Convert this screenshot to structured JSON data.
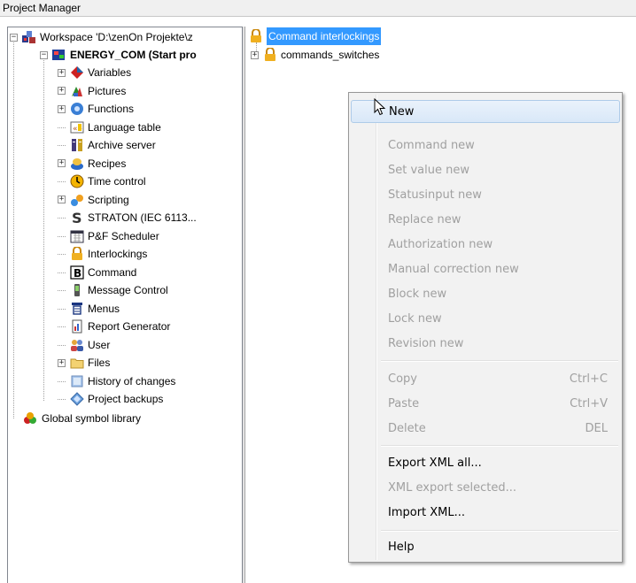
{
  "window": {
    "title": "Project Manager"
  },
  "tree": {
    "workspace_label": "Workspace 'D:\\zenOn Projekte\\z",
    "project_label": "ENERGY_COM (Start pro",
    "items": [
      {
        "label": "Variables",
        "icon": "variables-icon",
        "expandable": true
      },
      {
        "label": "Pictures",
        "icon": "pictures-icon",
        "expandable": true
      },
      {
        "label": "Functions",
        "icon": "functions-icon",
        "expandable": true
      },
      {
        "label": "Language table",
        "icon": "language-table-icon",
        "expandable": false
      },
      {
        "label": "Archive server",
        "icon": "archive-server-icon",
        "expandable": false
      },
      {
        "label": "Recipes",
        "icon": "recipes-icon",
        "expandable": true
      },
      {
        "label": "Time control",
        "icon": "clock-icon",
        "expandable": false
      },
      {
        "label": "Scripting",
        "icon": "scripting-icon",
        "expandable": true
      },
      {
        "label": "STRATON (IEC 6113...",
        "icon": "straton-icon",
        "expandable": false
      },
      {
        "label": "P&F Scheduler",
        "icon": "scheduler-icon",
        "expandable": false
      },
      {
        "label": "Interlockings",
        "icon": "interlockings-icon",
        "expandable": false
      },
      {
        "label": "Command",
        "icon": "command-icon",
        "expandable": false
      },
      {
        "label": "Message Control",
        "icon": "message-control-icon",
        "expandable": false
      },
      {
        "label": "Menus",
        "icon": "menus-icon",
        "expandable": false
      },
      {
        "label": "Report Generator",
        "icon": "report-generator-icon",
        "expandable": false
      },
      {
        "label": "User",
        "icon": "user-icon",
        "expandable": false
      },
      {
        "label": "Files",
        "icon": "folder-icon",
        "expandable": true
      },
      {
        "label": "History of changes",
        "icon": "history-icon",
        "expandable": false
      },
      {
        "label": "Project backups",
        "icon": "backup-icon",
        "expandable": false
      }
    ],
    "global_label": "Global symbol library"
  },
  "detail": {
    "root_label": "Command interlockings",
    "child_label": "commands_switches"
  },
  "context_menu": {
    "new": "New",
    "command_new": "Command new",
    "set_value_new": "Set value new",
    "statusinput_new": "Statusinput new",
    "replace_new": "Replace new",
    "authorization_new": "Authorization new",
    "manual_correction_new": "Manual correction new",
    "block_new": "Block new",
    "lock_new": "Lock new",
    "revision_new": "Revision new",
    "copy": "Copy",
    "copy_shortcut": "Ctrl+C",
    "paste": "Paste",
    "paste_shortcut": "Ctrl+V",
    "delete": "Delete",
    "delete_shortcut": "DEL",
    "export_xml_all": "Export XML all...",
    "xml_export_selected": "XML export selected...",
    "import_xml": "Import XML...",
    "help": "Help"
  },
  "colors": {
    "selection": "#3399ff",
    "disabled_text": "#a0a0a0",
    "menu_bg": "#f2f2f2"
  }
}
